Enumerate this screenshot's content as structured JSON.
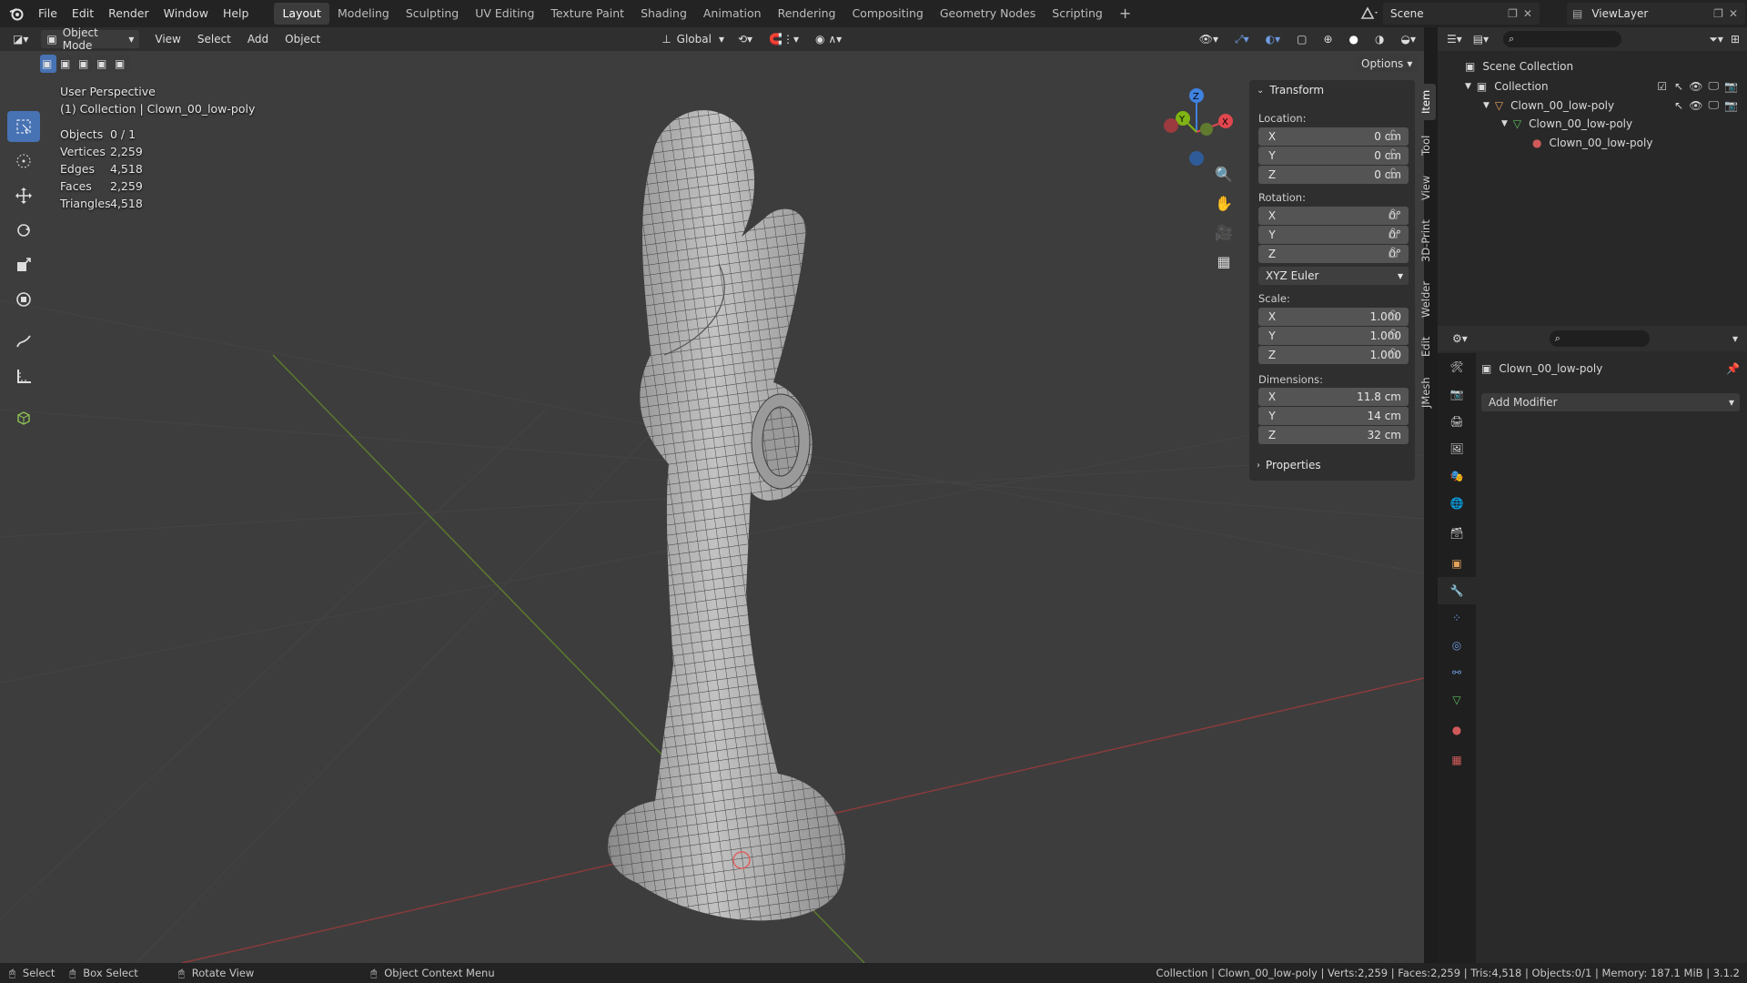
{
  "menu": [
    "File",
    "Edit",
    "Render",
    "Window",
    "Help"
  ],
  "workspaces": [
    "Layout",
    "Modeling",
    "Sculpting",
    "UV Editing",
    "Texture Paint",
    "Shading",
    "Animation",
    "Rendering",
    "Compositing",
    "Geometry Nodes",
    "Scripting"
  ],
  "active_workspace": "Layout",
  "scene_name": "Scene",
  "view_layer": "ViewLayer",
  "viewport_header": {
    "mode": "Object Mode",
    "menus": [
      "View",
      "Select",
      "Add",
      "Object"
    ],
    "orientation": "Global",
    "options": "Options"
  },
  "overlay": {
    "view_name": "User Perspective",
    "collection_line": "(1) Collection | Clown_00_low-poly",
    "stats": [
      {
        "label": "Objects",
        "value": "0 / 1"
      },
      {
        "label": "Vertices",
        "value": "2,259"
      },
      {
        "label": "Edges",
        "value": "4,518"
      },
      {
        "label": "Faces",
        "value": "2,259"
      },
      {
        "label": "Triangles",
        "value": "4,518"
      }
    ]
  },
  "transform": {
    "title": "Transform",
    "location_label": "Location:",
    "location": [
      {
        "ax": "X",
        "val": "0 cm"
      },
      {
        "ax": "Y",
        "val": "0 cm"
      },
      {
        "ax": "Z",
        "val": "0 cm"
      }
    ],
    "rotation_label": "Rotation:",
    "rotation": [
      {
        "ax": "X",
        "val": "0°"
      },
      {
        "ax": "Y",
        "val": "0°"
      },
      {
        "ax": "Z",
        "val": "0°"
      }
    ],
    "rotation_mode": "XYZ Euler",
    "scale_label": "Scale:",
    "scale": [
      {
        "ax": "X",
        "val": "1.000"
      },
      {
        "ax": "Y",
        "val": "1.000"
      },
      {
        "ax": "Z",
        "val": "1.000"
      }
    ],
    "dimensions_label": "Dimensions:",
    "dimensions": [
      {
        "ax": "X",
        "val": "11.8 cm"
      },
      {
        "ax": "Y",
        "val": "14 cm"
      },
      {
        "ax": "Z",
        "val": "32 cm"
      }
    ],
    "properties_label": "Properties"
  },
  "side_tabs": [
    "Item",
    "Tool",
    "View",
    "3D-Print",
    "Welder",
    "Edit",
    "JMesh"
  ],
  "outliner": {
    "scene_collection": "Scene Collection",
    "collection": "Collection",
    "object": "Clown_00_low-poly",
    "mesh": "Clown_00_low-poly",
    "material": "Clown_00_low-poly"
  },
  "properties": {
    "object_name": "Clown_00_low-poly",
    "add_modifier": "Add Modifier"
  },
  "statusbar": {
    "select": "Select",
    "box_select": "Box Select",
    "rotate_view": "Rotate View",
    "context_menu": "Object Context Menu",
    "info": "Collection | Clown_00_low-poly | Verts:2,259 | Faces:2,259 | Tris:4,518 | Objects:0/1 | Memory: 187.1 MiB | 3.1.2"
  },
  "colors": {
    "accent": "#4772b3",
    "x_axis": "#e0464e",
    "y_axis": "#7fb414",
    "z_axis": "#3f82df",
    "grid_red": "#8a3b3b",
    "grid_green": "#5d7a2e"
  }
}
